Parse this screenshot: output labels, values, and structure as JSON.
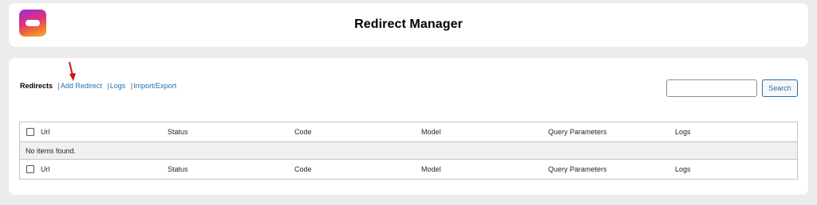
{
  "header": {
    "title": "Redirect Manager",
    "logo_icon": "app-logo-icon"
  },
  "nav": {
    "current": "Redirects",
    "separator": "|",
    "links": [
      "Add Redirect",
      "Logs",
      "Import/Export"
    ]
  },
  "search": {
    "value": "",
    "placeholder": "",
    "button_label": "Search"
  },
  "table": {
    "columns": [
      "Url",
      "Status",
      "Code",
      "Model",
      "Query Parameters",
      "Logs"
    ],
    "empty_message": "No items found."
  },
  "colors": {
    "link": "#2271b1",
    "arrow": "#d20f0f",
    "background": "#ececec"
  }
}
